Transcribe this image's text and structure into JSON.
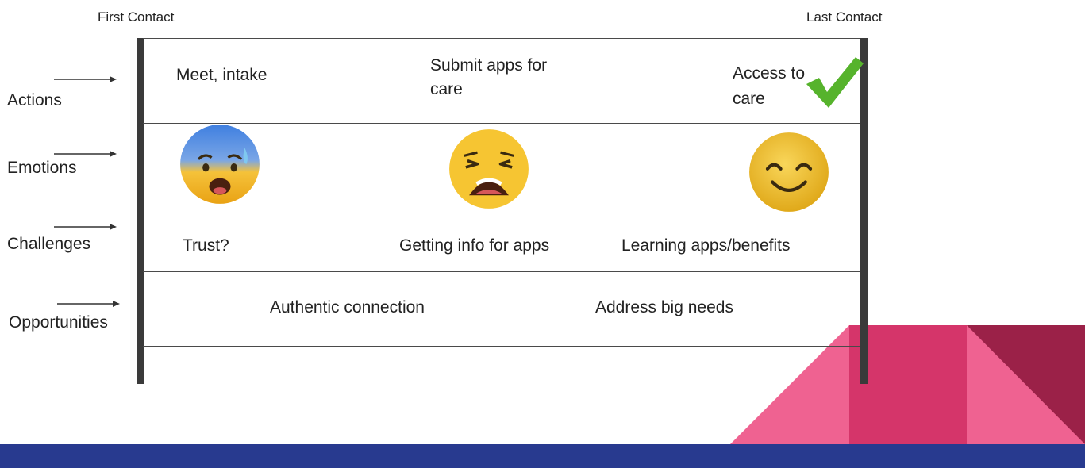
{
  "header": {
    "first": "First Contact",
    "last": "Last Contact"
  },
  "rows": {
    "actions": "Actions",
    "emotions": "Emotions",
    "challenges": "Challenges",
    "opportunities": "Opportunities"
  },
  "actions": {
    "a1": "Meet, intake",
    "a2_line1": "Submit apps for",
    "a2_line2": "care",
    "a3_line1": "Access to",
    "a3_line2": "care"
  },
  "emotions": {
    "e1": "anxious-sweat-face-icon",
    "e2": "weary-face-icon",
    "e3": "smiling-face-icon"
  },
  "challenges": {
    "c1": "Trust?",
    "c2": "Getting info for apps",
    "c3": "Learning apps/benefits"
  },
  "opportunities": {
    "o1": "Authentic connection",
    "o2": "Address big needs"
  },
  "colors": {
    "footer_blue": "#283a8f",
    "pink": "#ef6291",
    "magenta": "#d5356a",
    "maroon": "#9b2148",
    "check_green": "#56b32c"
  }
}
